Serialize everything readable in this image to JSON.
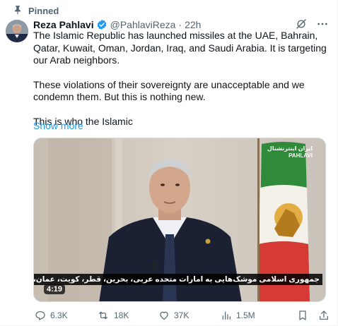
{
  "pinned": {
    "label": "Pinned"
  },
  "post": {
    "author_name": "Reza Pahlavi",
    "handle": "@PahlaviReza",
    "separator": "·",
    "time": "22h",
    "paragraphs": [
      "The Islamic Republic has launched missiles at the UAE, Bahrain, Qatar, Kuwait, Oman, Jordan, Iraq, and Saudi Arabia. It is targeting our Arab neighbors.",
      "These violations of their sovereignty are unacceptable and we condemn them. But this is nothing new.",
      "This is who the Islamic"
    ],
    "show_more": "Show more"
  },
  "media": {
    "duration": "4:19",
    "caption": "جمهوری اسلامی موشک‌هایی به امارات متحده عربی، بحرین، قطر، کویت، عمان،",
    "watermark_line1": "ایران اینترنشنال",
    "watermark_line2": "PAHLAVI"
  },
  "actions": {
    "replies": "6.3K",
    "reposts": "18K",
    "likes": "37K",
    "views": "1.5M"
  },
  "icons": {
    "pin": "pin-icon",
    "verified": "verified-badge-icon",
    "grok": "grok-icon",
    "more": "more-icon",
    "reply": "reply-icon",
    "repost": "repost-icon",
    "like": "like-icon",
    "views": "views-icon",
    "bookmark": "bookmark-icon",
    "share": "share-icon"
  },
  "colors": {
    "text_primary": "#0f1419",
    "text_secondary": "#536471",
    "link": "#1d9bf0",
    "verified": "#1d9bf0"
  }
}
